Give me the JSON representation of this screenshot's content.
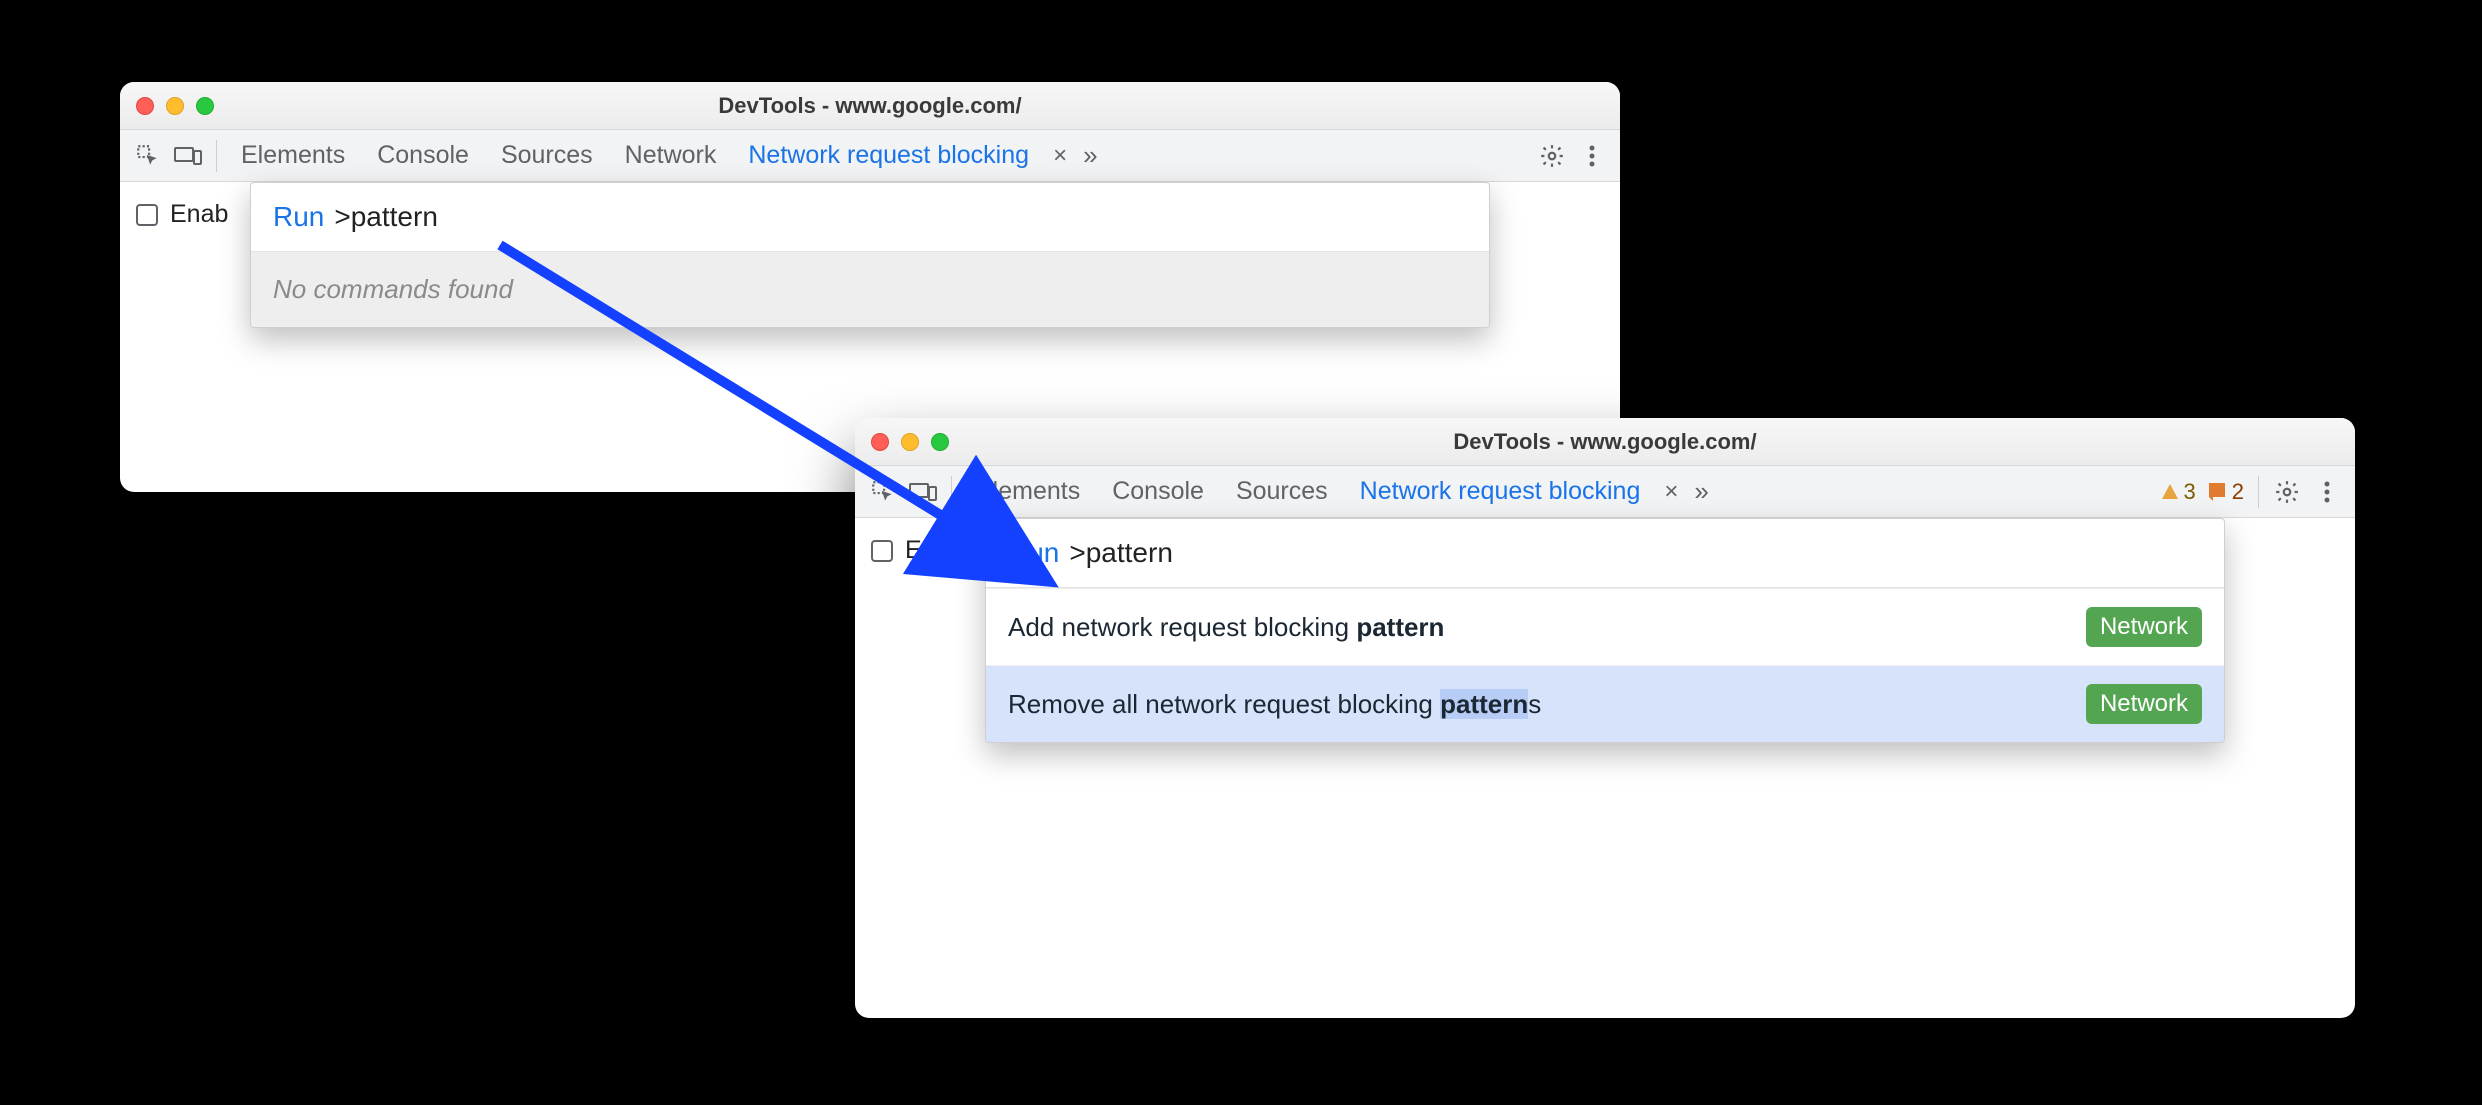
{
  "windowA": {
    "title": "DevTools - www.google.com/",
    "tabs": {
      "elements": "Elements",
      "console": "Console",
      "sources": "Sources",
      "network": "Network",
      "blocking": "Network request blocking"
    },
    "enable_label": "Enab",
    "palette": {
      "prefix": "Run",
      "query": ">pattern",
      "empty": "No commands found"
    }
  },
  "windowB": {
    "title": "DevTools - www.google.com/",
    "tabs": {
      "elements": "Elements",
      "console": "Console",
      "sources": "Sources",
      "blocking": "Network request blocking"
    },
    "warnings_count": "3",
    "issues_count": "2",
    "enable_label": "Enab",
    "palette": {
      "prefix": "Run",
      "query": ">pattern",
      "results": [
        {
          "pre": "Add network request blocking ",
          "match": "pattern",
          "post": "",
          "chip": "Network"
        },
        {
          "pre": "Remove all network request blocking ",
          "match": "pattern",
          "post": "s",
          "chip": "Network"
        }
      ]
    }
  }
}
